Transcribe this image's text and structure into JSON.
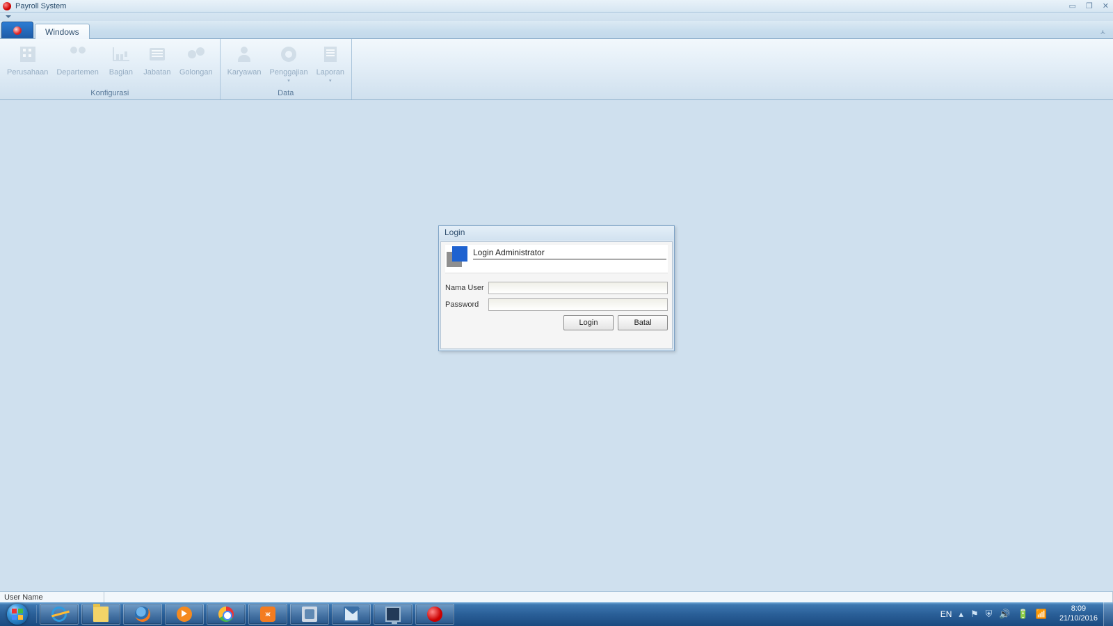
{
  "window": {
    "title": "Payroll System"
  },
  "ribbon": {
    "file_tab": "",
    "tabs": [
      {
        "label": "Windows"
      }
    ],
    "groups": [
      {
        "label": "Konfigurasi",
        "items": [
          {
            "label": "Perusahaan",
            "icon": "building",
            "dropdown": false
          },
          {
            "label": "Departemen",
            "icon": "people",
            "dropdown": false
          },
          {
            "label": "Bagian",
            "icon": "chart",
            "dropdown": false
          },
          {
            "label": "Jabatan",
            "icon": "card",
            "dropdown": false
          },
          {
            "label": "Golongan",
            "icon": "circles",
            "dropdown": false
          }
        ]
      },
      {
        "label": "Data",
        "items": [
          {
            "label": "Karyawan",
            "icon": "person",
            "dropdown": false
          },
          {
            "label": "Penggajian",
            "icon": "gear",
            "dropdown": true
          },
          {
            "label": "Laporan",
            "icon": "doc",
            "dropdown": true
          }
        ]
      }
    ]
  },
  "login": {
    "title": "Login",
    "header": "Login Administrator",
    "fields": {
      "username_label": "Nama User",
      "username_value": "",
      "password_label": "Password",
      "password_value": ""
    },
    "buttons": {
      "login": "Login",
      "cancel": "Batal"
    }
  },
  "statusbar": {
    "username_label": "User Name",
    "username_value": ""
  },
  "taskbar": {
    "apps": [
      {
        "name": "internet-explorer",
        "icon": "ie"
      },
      {
        "name": "file-explorer",
        "icon": "folder"
      },
      {
        "name": "firefox",
        "icon": "ff"
      },
      {
        "name": "media-player",
        "icon": "play"
      },
      {
        "name": "chrome",
        "icon": "chrome"
      },
      {
        "name": "xampp",
        "icon": "xampp"
      },
      {
        "name": "app-generic-1",
        "icon": "generic"
      },
      {
        "name": "mail",
        "icon": "mail"
      },
      {
        "name": "app-screen",
        "icon": "screen"
      },
      {
        "name": "payroll-system",
        "icon": "red"
      }
    ],
    "systray": {
      "language": "EN",
      "chevron": "▴",
      "icons": [
        "⚑",
        "⛨",
        "🔊",
        "🔋",
        "📶"
      ]
    },
    "clock": {
      "time": "8:09",
      "date": "21/10/2016"
    }
  }
}
